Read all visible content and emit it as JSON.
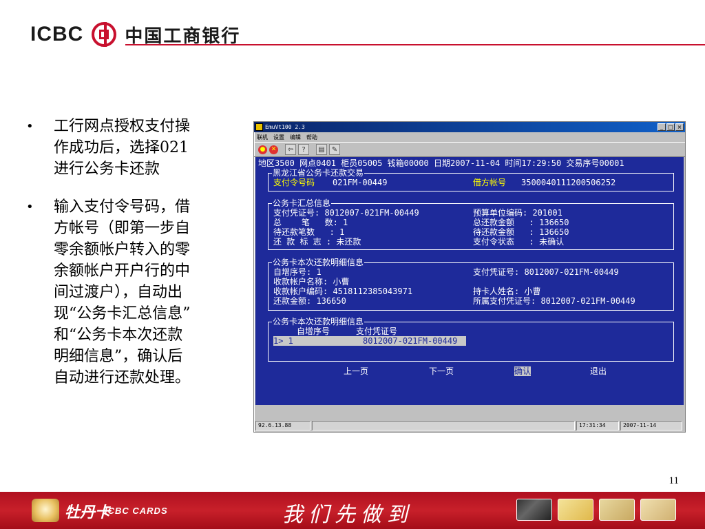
{
  "header": {
    "logo_text": "ICBC",
    "bank_name": "中国工商银行"
  },
  "bullets": [
    {
      "symbol": "•",
      "text": "工行网点授权支付操\n作成功后，选择021\n进行公务卡还款"
    },
    {
      "symbol": "•",
      "text": "输入支付令号码，借\n方帐号（即第一步自\n零余额帐户转入的零\n余额帐户开户行的中\n间过渡户），自动出\n现“公务卡汇总信息”\n和“公务卡本次还款\n明细信息”，确认后\n自动进行还款处理。"
    }
  ],
  "window": {
    "title": "EmuVt100  2.3",
    "controls": [
      "_",
      "□",
      "×"
    ],
    "menu": [
      "联机",
      "设置",
      "编辑",
      "帮助"
    ],
    "toolbar_icons": [
      "connect-icon",
      "disconnect-icon",
      "send-icon",
      "help-icon",
      "print-icon",
      "edit-icon"
    ],
    "screen": {
      "header_line": "地区3500 网点0401 柜员05005 钱箱00000 日期2007-11-04 时间17:29:50 交易序号00001",
      "tx_box": {
        "legend": "黑龙江省公务卡还款交易",
        "pay_order_label": "支付令号码",
        "pay_order_value": "021FM-00449",
        "debit_account_label": "借方帐号",
        "debit_account_value": "3500040111200506252"
      },
      "summary_box": {
        "legend": "公务卡汇总信息",
        "left": [
          "支付凭证号: 8012007-021FM-00449",
          "总    笔   数: 1",
          "待还款笔数   : 1",
          "还 款 标 志 : 未还款"
        ],
        "right": [
          "预算单位编码: 201001",
          "总还款金额   : 136650",
          "待还款金额   : 136650",
          "支付令状态   : 未确认"
        ]
      },
      "detail_box": {
        "legend": "公务卡本次还款明细信息",
        "left": [
          "自增序号: 1",
          "收款帐户名称: 小曹",
          "收款帐户编码: 4518112385043971",
          "还款金额: 136650"
        ],
        "right": [
          "",
          "支付凭证号: 8012007-021FM-00449",
          "",
          "持卡人姓名: 小曹",
          "所属支付凭证号: 8012007-021FM-00449"
        ]
      },
      "list_box": {
        "legend": "公务卡本次还款明细信息",
        "col_seq": "自增序号",
        "col_voucher": "支付凭证号",
        "row": "1> 1              8012007-021FM-00449"
      },
      "actions": {
        "prev": "上一页",
        "next": "下一页",
        "confirm": "确认",
        "exit": "退出"
      }
    },
    "status": {
      "ip": "92.6.13.88",
      "time": "17:31:34",
      "date": "2007-11-14"
    }
  },
  "page_number": "11",
  "footer": {
    "brand_cn": "牡丹卡",
    "brand_en": "ICBC CARDS",
    "slogan": "我们先做到"
  },
  "colors": {
    "brand_red": "#c8102e",
    "terminal_bg": "#1e2a9a",
    "terminal_highlight": "#ffff00"
  }
}
